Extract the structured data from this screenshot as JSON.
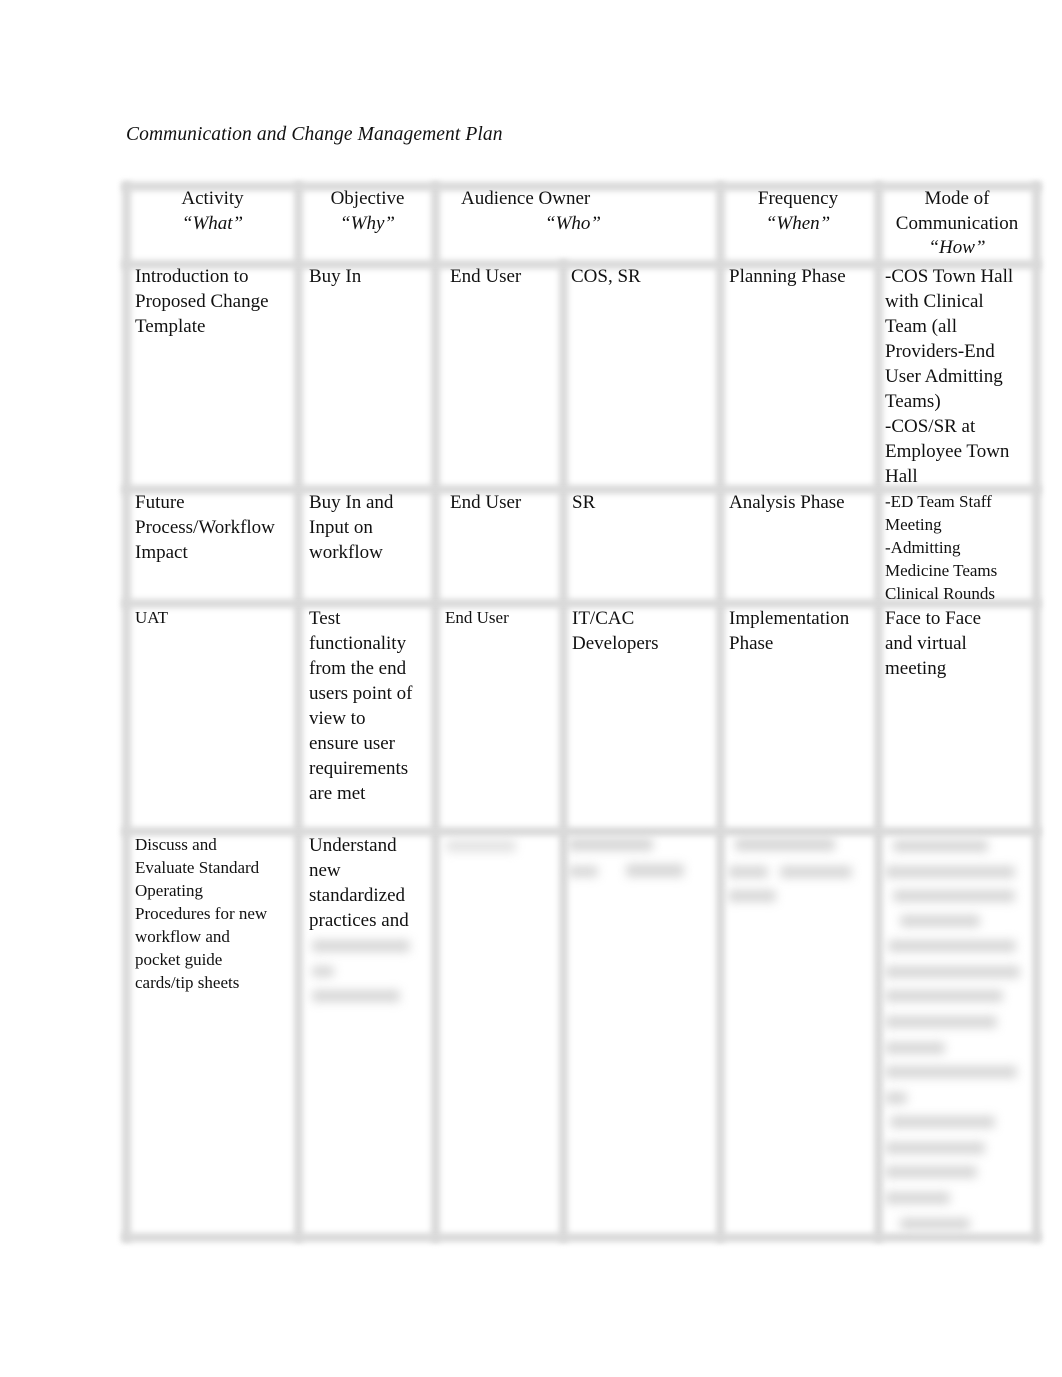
{
  "document": {
    "title": "Communication and Change Management Plan"
  },
  "table": {
    "headers": {
      "activity": {
        "label": "Activity",
        "sub": "“What”"
      },
      "objective": {
        "label": "Objective",
        "sub": "“Why”"
      },
      "audience_owner": {
        "label": "Audience Owner",
        "sub": "“Who”"
      },
      "frequency": {
        "label": "Frequency",
        "sub": "“When”"
      },
      "mode": {
        "label": "Mode of\nCommunication",
        "sub": "“How”"
      }
    },
    "rows": [
      {
        "activity": "Introduction to\nProposed Change\nTemplate",
        "objective": "Buy In",
        "audience": "End User",
        "owner": "COS, SR",
        "frequency": "Planning Phase",
        "mode": "-COS Town Hall\nwith Clinical\nTeam (all\nProviders-End\nUser Admitting\nTeams)\n-COS/SR at\nEmployee Town\nHall"
      },
      {
        "activity": "Future\nProcess/Workflow\nImpact",
        "objective": " Buy In and\nInput on\nworkflow",
        "audience": "End User",
        "owner": " SR",
        "frequency": "Analysis Phase",
        "mode": "-ED Team Staff\nMeeting\n-Admitting\nMedicine Teams\nClinical Rounds"
      },
      {
        "activity": "UAT",
        "objective": " Test\nfunctionality\nfrom the end\nusers point of\nview to\nensure user\nrequirements\nare met",
        "audience": "End User",
        "owner": " IT/CAC\nDevelopers",
        "frequency": " Implementation\nPhase",
        "mode": " Face to Face\nand virtual\nmeeting"
      },
      {
        "activity": "Discuss and\nEvaluate Standard\nOperating\nProcedures for new\nworkflow and\npocket guide\ncards/tip sheets",
        "objective": " Understand\nnew\nstandardized\npractices and",
        "audience": "",
        "owner": "",
        "frequency": "",
        "mode": "",
        "obscured_note": "remaining text in this row is blurred / not legible"
      }
    ]
  }
}
